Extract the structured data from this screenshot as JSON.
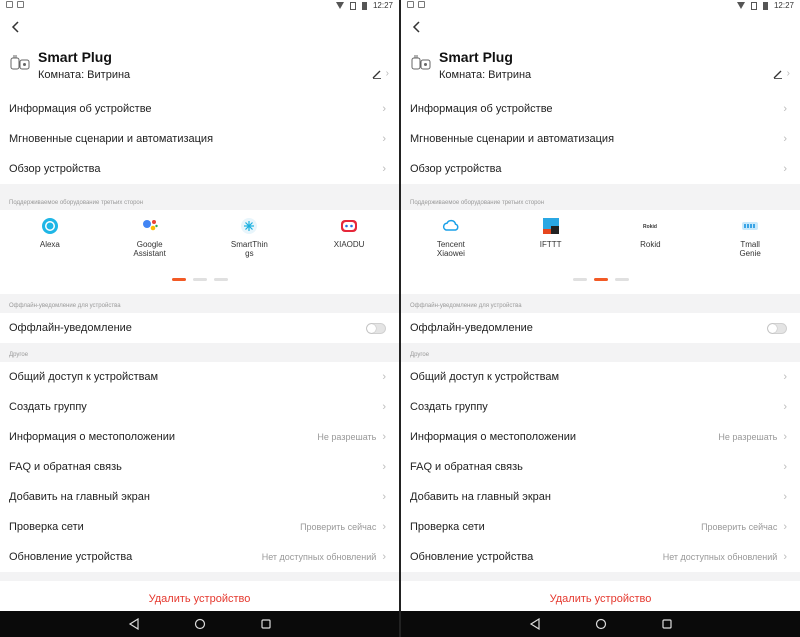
{
  "colors": {
    "accent": "#f25a25",
    "danger": "#e5382e"
  },
  "status_bar": {
    "time": "12:27"
  },
  "screens": [
    {
      "device": {
        "name": "Smart Plug",
        "room": "Комната: Витрина"
      },
      "menu_top": [
        {
          "label": "Информация об устройстве"
        },
        {
          "label": "Мгновенные сценарии и автоматизация"
        },
        {
          "label": "Обзор устройства"
        }
      ],
      "third_party_title": "Поддерживаемое оборудование третьих сторон",
      "services": [
        {
          "label": "Alexa",
          "icon": "alexa-icon"
        },
        {
          "label": "Google Assistant",
          "icon": "google-assistant-icon"
        },
        {
          "label": "SmartThings",
          "icon": "smartthings-icon"
        },
        {
          "label": "XIAODU",
          "icon": "xiaodu-icon"
        }
      ],
      "pager_active": 1,
      "offline_section": "Оффлайн-уведомление для устройства",
      "offline_label": "Оффлайн-уведомление",
      "other_section": "Другое",
      "other_rows": [
        {
          "label": "Общий доступ к устройствам",
          "value": ""
        },
        {
          "label": "Создать группу",
          "value": ""
        },
        {
          "label": "Информация о местоположении",
          "value": "Не разрешать"
        },
        {
          "label": "FAQ и обратная связь",
          "value": ""
        },
        {
          "label": "Добавить на главный экран",
          "value": ""
        },
        {
          "label": "Проверка сети",
          "value": "Проверить сейчас"
        },
        {
          "label": "Обновление устройства",
          "value": "Нет доступных обновлений"
        }
      ],
      "delete_label": "Удалить устройство"
    },
    {
      "device": {
        "name": "Smart Plug",
        "room": "Комната: Витрина"
      },
      "menu_top": [
        {
          "label": "Информация об устройстве"
        },
        {
          "label": "Мгновенные сценарии и автоматизация"
        },
        {
          "label": "Обзор устройства"
        }
      ],
      "third_party_title": "Поддерживаемое оборудование третьих сторон",
      "services": [
        {
          "label": "Tencent Xiaowei",
          "icon": "tencent-xiaowei-icon"
        },
        {
          "label": "IFTTT",
          "icon": "ifttt-icon"
        },
        {
          "label": "Rokid",
          "icon": "rokid-icon"
        },
        {
          "label": "Tmall Genie",
          "icon": "tmall-genie-icon"
        }
      ],
      "pager_active": 2,
      "offline_section": "Оффлайн-уведомление для устройства",
      "offline_label": "Оффлайн-уведомление",
      "other_section": "Другое",
      "other_rows": [
        {
          "label": "Общий доступ к устройствам",
          "value": ""
        },
        {
          "label": "Создать группу",
          "value": ""
        },
        {
          "label": "Информация о местоположении",
          "value": "Не разрешать"
        },
        {
          "label": "FAQ и обратная связь",
          "value": ""
        },
        {
          "label": "Добавить на главный экран",
          "value": ""
        },
        {
          "label": "Проверка сети",
          "value": "Проверить сейчас"
        },
        {
          "label": "Обновление устройства",
          "value": "Нет доступных обновлений"
        }
      ],
      "delete_label": "Удалить устройство"
    }
  ]
}
